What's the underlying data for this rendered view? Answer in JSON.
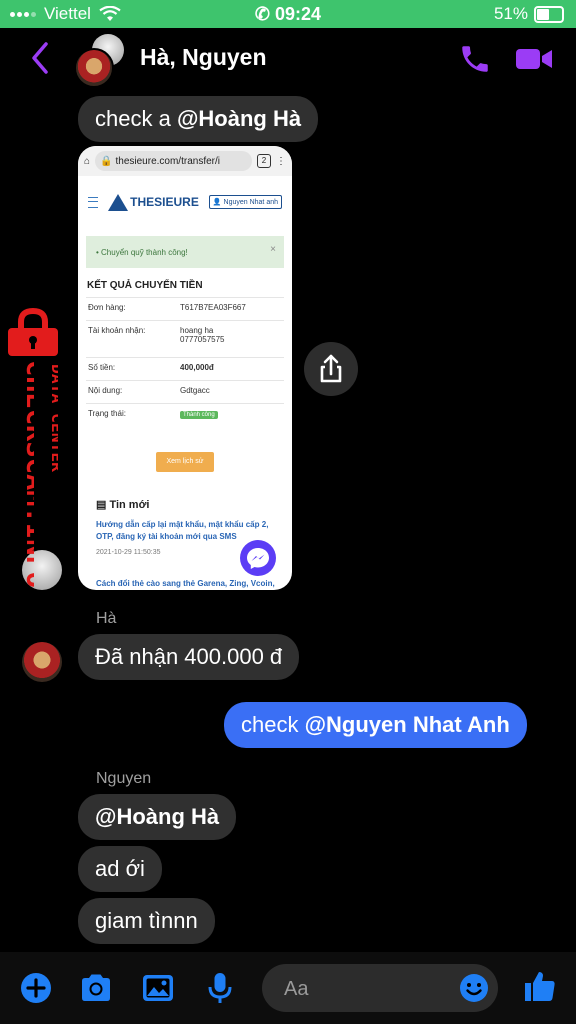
{
  "status": {
    "carrier": "Viettel",
    "time": "09:24",
    "battery": "51%"
  },
  "header": {
    "title": "Hà, Nguyen"
  },
  "messages": {
    "m1_text": "check a ",
    "m1_mention": "@Hoàng Hà",
    "sender_ha": "Hà",
    "m2_text": "Đã nhận 400.000 đ",
    "m3_text": "check ",
    "m3_mention": "@Nguyen Nhat Anh",
    "sender_nguyen": "Nguyen",
    "m4_mention": "@Hoàng Hà",
    "m5_text": "ad ới",
    "m6_text": "giam tìnnn"
  },
  "screenshot": {
    "url": "thesieure.com/transfer/i",
    "tab_count": "2",
    "brand": "THESIEURE",
    "user": "Nguyen Nhat anh",
    "alert": "Chuyển quỹ thành công!",
    "alert_close": "×",
    "result_title": "KẾT QUẢ CHUYỂN TIỀN",
    "rows": [
      {
        "k": "Đơn hàng:",
        "v": "T617B7EA03F667"
      },
      {
        "k": "Tài khoản nhận:",
        "v": "hoang ha",
        "v2": "0777057575"
      },
      {
        "k": "Số tiền:",
        "v": "400,000đ"
      },
      {
        "k": "Nội dung:",
        "v": "Gdtgacc"
      },
      {
        "k": "Trạng thái:",
        "v": "Thành công"
      }
    ],
    "history_btn": "Xem lịch sử",
    "news_title": "Tin mới",
    "news_link": "Hướng dẫn cấp lại mật khẩu, mật khẩu cấp 2, OTP, đăng ký tài khoản mới qua SMS",
    "news_date": "2021-10-29 11:50:35",
    "news_link2": "Cách đổi thẻ cào sang thẻ Garena, Zing, Vcoin, Gosu, Soha, Gate, Funcard, Appota, Scoin."
  },
  "watermark": {
    "main": "CHECKSCAM.INFO",
    "sub": "DATA CENTER"
  },
  "composer": {
    "placeholder": "Aa"
  },
  "colors": {
    "status_green": "#3ec46d",
    "accent_purple": "#9b3cf5",
    "messenger_blue": "#1f7ff5",
    "my_bubble": "#3a6ff5",
    "other_bubble": "#303030",
    "watermark_red": "#e21c1c"
  }
}
